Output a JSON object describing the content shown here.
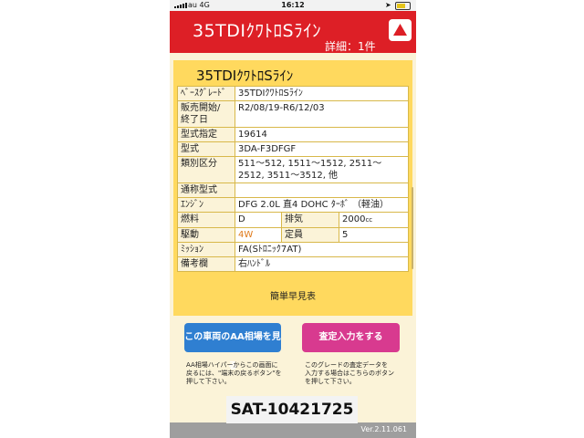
{
  "status_bar": {
    "carrier": "au 4G",
    "time": "16:12"
  },
  "header": {
    "title": "35TDIｸﾜﾄﾛSﾗｲﾝ",
    "detail": "詳細：1件"
  },
  "card": {
    "title": "35TDIｸﾜﾄﾛSﾗｲﾝ",
    "rows": {
      "base_grade": {
        "label": "ﾍﾞｰｽｸﾞﾚｰﾄﾞ",
        "value": "35TDIｸﾜﾄﾛSﾗｲﾝ"
      },
      "sales_period": {
        "label1": "販売開始/",
        "label2": "終了日",
        "value": "R2/08/19-R6/12/03"
      },
      "model_designation": {
        "label": "型式指定",
        "value": "19614"
      },
      "model": {
        "label": "型式",
        "value": "3DA-F3DFGF"
      },
      "category": {
        "label": "類別区分",
        "value": "511～512, 1511～1512, 2511～2512, 3511～3512, 他"
      },
      "common_model": {
        "label": "通称型式",
        "value": ""
      },
      "engine": {
        "label": "ｴﾝｼﾞﾝ",
        "value": "DFG 2.0L 直4 DOHC ﾀｰﾎﾞ （軽油）"
      },
      "fuel": {
        "label": "燃料",
        "value": "D",
        "label2": "排気",
        "value2_main": "2000",
        "value2_unit": "cc"
      },
      "drive": {
        "label": "駆動",
        "value": "4W",
        "label2": "定員",
        "value2": "5"
      },
      "transmission": {
        "label": "ﾐｯｼｮﾝ",
        "value": "FA(Sﾄﾛﾆｯｸ7AT)"
      },
      "remarks": {
        "label": "備考欄",
        "value": "右ﾊﾝﾄﾞﾙ"
      }
    },
    "simple_table": "簡単早見表"
  },
  "buttons": {
    "aa_price": "この車両のAA相場を見る",
    "appraisal": "査定入力をする"
  },
  "notes": {
    "left": [
      "AA相場ハイパーからこの画面に",
      "戻るには、\"端末の戻るボタン\"を",
      "押して下さい。"
    ],
    "right": [
      "このグレードの査定データを",
      "入力する場合はこちらのボタン",
      "を押して下さい。"
    ]
  },
  "footer": {
    "version": "Ver.2.11.061"
  },
  "overlay": {
    "sat_id": "SAT-10421725"
  },
  "colors": {
    "header_red": "#dd1f26",
    "card_yellow": "#ffd95e",
    "button_blue": "#2f7fd1",
    "button_pink": "#d83a8f",
    "drive_orange": "#e07a1a"
  }
}
